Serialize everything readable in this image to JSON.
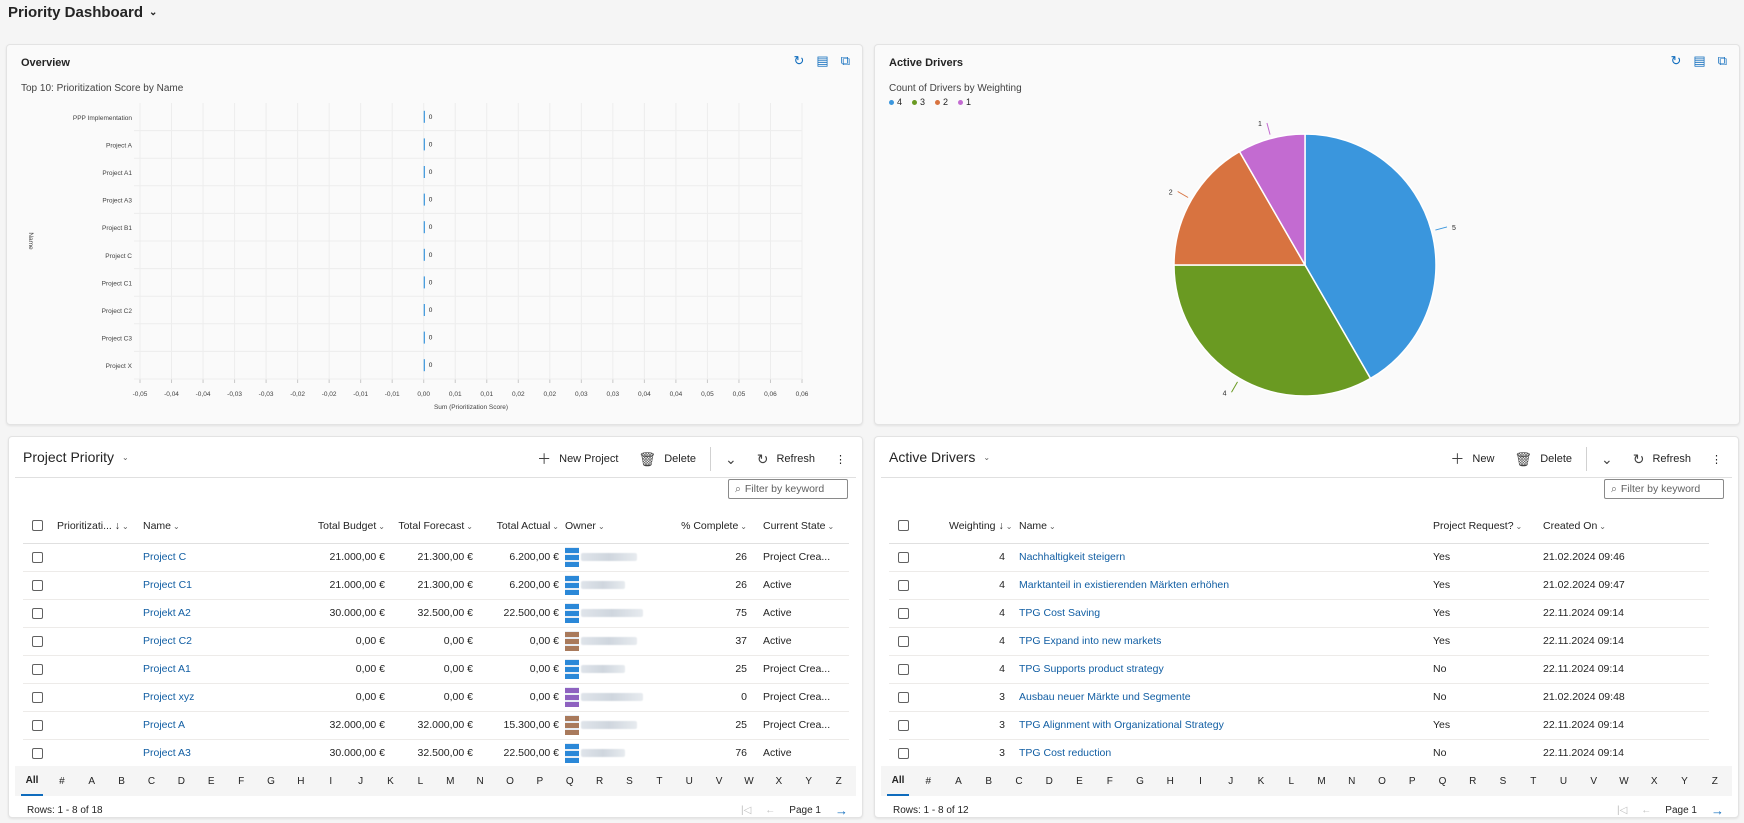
{
  "dashboard": {
    "title": "Priority Dashboard"
  },
  "overview": {
    "title": "Overview",
    "subtitle": "Top 10: Prioritization Score by Name"
  },
  "drivers_chart": {
    "title": "Active Drivers",
    "subtitle": "Count of Drivers by Weighting"
  },
  "chart_data": [
    {
      "type": "bar",
      "orientation": "horizontal",
      "title": "Top 10: Prioritization Score by Name",
      "xlabel": "Sum (Prioritization Score)",
      "ylabel": "Name",
      "categories": [
        "PPP Implementation",
        "Project A",
        "Project A1",
        "Project A3",
        "Project B1",
        "Project C",
        "Project C1",
        "Project C2",
        "Project C3",
        "Project X"
      ],
      "values": [
        0,
        0,
        0,
        0,
        0,
        0,
        0,
        0,
        0,
        0
      ],
      "data_labels": [
        "0",
        "0",
        "0",
        "0",
        "0",
        "0",
        "0",
        "0",
        "0",
        "0"
      ],
      "xlim": [
        -0.045,
        0.06
      ],
      "xticks": [
        "-0,05",
        "-0,04",
        "-0,04",
        "-0,03",
        "-0,03",
        "-0,02",
        "-0,02",
        "-0,01",
        "-0,01",
        "0,00",
        "0,01",
        "0,01",
        "0,02",
        "0,02",
        "0,03",
        "0,03",
        "0,04",
        "0,04",
        "0,05",
        "0,05",
        "0,06",
        "0,06"
      ],
      "grid": true,
      "color": "#3a96dd"
    },
    {
      "type": "pie",
      "title": "Count of Drivers by Weighting",
      "legend_position": "top-left",
      "slices": [
        {
          "label": "4",
          "value": 5,
          "color": "#3a96dd"
        },
        {
          "label": "3",
          "value": 4,
          "color": "#6a9a22"
        },
        {
          "label": "2",
          "value": 2,
          "color": "#d87340"
        },
        {
          "label": "1",
          "value": 1,
          "color": "#c36bd1"
        }
      ]
    }
  ],
  "project_grid": {
    "title": "Project Priority",
    "new_label": "New Project",
    "delete_label": "Delete",
    "refresh_label": "Refresh",
    "filter_placeholder": "Filter by keyword",
    "columns": [
      "Prioritizati...",
      "Name",
      "Total Budget",
      "Total Forecast",
      "Total Actual",
      "Owner",
      "% Complete",
      "Current State"
    ],
    "rows": [
      {
        "name": "Project C",
        "budget": "21.000,00 €",
        "forecast": "21.300,00 €",
        "actual": "6.200,00 €",
        "owner_color": "#2b88d8",
        "complete": "26",
        "state": "Project Crea..."
      },
      {
        "name": "Project C1",
        "budget": "21.000,00 €",
        "forecast": "21.300,00 €",
        "actual": "6.200,00 €",
        "owner_color": "#2b88d8",
        "complete": "26",
        "state": "Active"
      },
      {
        "name": "Projekt A2",
        "budget": "30.000,00 €",
        "forecast": "32.500,00 €",
        "actual": "22.500,00 €",
        "owner_color": "#2b88d8",
        "complete": "75",
        "state": "Active"
      },
      {
        "name": "Project C2",
        "budget": "0,00 €",
        "forecast": "0,00 €",
        "actual": "0,00 €",
        "owner_color": "#a97a5c",
        "complete": "37",
        "state": "Active"
      },
      {
        "name": "Project A1",
        "budget": "0,00 €",
        "forecast": "0,00 €",
        "actual": "0,00 €",
        "owner_color": "#2b88d8",
        "complete": "25",
        "state": "Project Crea..."
      },
      {
        "name": "Project xyz",
        "budget": "0,00 €",
        "forecast": "0,00 €",
        "actual": "0,00 €",
        "owner_color": "#8e62c0",
        "complete": "0",
        "state": "Project Crea..."
      },
      {
        "name": "Project A",
        "budget": "32.000,00 €",
        "forecast": "32.000,00 €",
        "actual": "15.300,00 €",
        "owner_color": "#a97a5c",
        "complete": "25",
        "state": "Project Crea..."
      },
      {
        "name": "Project A3",
        "budget": "30.000,00 €",
        "forecast": "32.500,00 €",
        "actual": "22.500,00 €",
        "owner_color": "#2b88d8",
        "complete": "76",
        "state": "Active"
      }
    ],
    "rows_label": "Rows: 1 - 8 of 18",
    "page_label": "Page 1"
  },
  "drivers_grid": {
    "title": "Active Drivers",
    "new_label": "New",
    "delete_label": "Delete",
    "refresh_label": "Refresh",
    "filter_placeholder": "Filter by keyword",
    "columns": [
      "Weighting",
      "Name",
      "Project Request?",
      "Created On"
    ],
    "rows": [
      {
        "w": "4",
        "name": "Nachhaltigkeit steigern",
        "req": "Yes",
        "created": "21.02.2024 09:46"
      },
      {
        "w": "4",
        "name": "Marktanteil in existierenden Märkten erhöhen",
        "req": "Yes",
        "created": "21.02.2024 09:47"
      },
      {
        "w": "4",
        "name": "TPG Cost Saving",
        "req": "Yes",
        "created": "22.11.2024 09:14"
      },
      {
        "w": "4",
        "name": "TPG Expand into new markets",
        "req": "Yes",
        "created": "22.11.2024 09:14"
      },
      {
        "w": "4",
        "name": "TPG Supports product strategy",
        "req": "No",
        "created": "22.11.2024 09:14"
      },
      {
        "w": "3",
        "name": "Ausbau neuer Märkte und Segmente",
        "req": "No",
        "created": "21.02.2024 09:48"
      },
      {
        "w": "3",
        "name": "TPG Alignment with Organizational Strategy",
        "req": "Yes",
        "created": "22.11.2024 09:14"
      },
      {
        "w": "3",
        "name": "TPG Cost reduction",
        "req": "No",
        "created": "22.11.2024 09:14"
      }
    ],
    "rows_label": "Rows: 1 - 8 of 12",
    "page_label": "Page 1"
  },
  "alphabet": [
    "All",
    "#",
    "A",
    "B",
    "C",
    "D",
    "E",
    "F",
    "G",
    "H",
    "I",
    "J",
    "K",
    "L",
    "M",
    "N",
    "O",
    "P",
    "Q",
    "R",
    "S",
    "T",
    "U",
    "V",
    "W",
    "X",
    "Y",
    "Z"
  ]
}
